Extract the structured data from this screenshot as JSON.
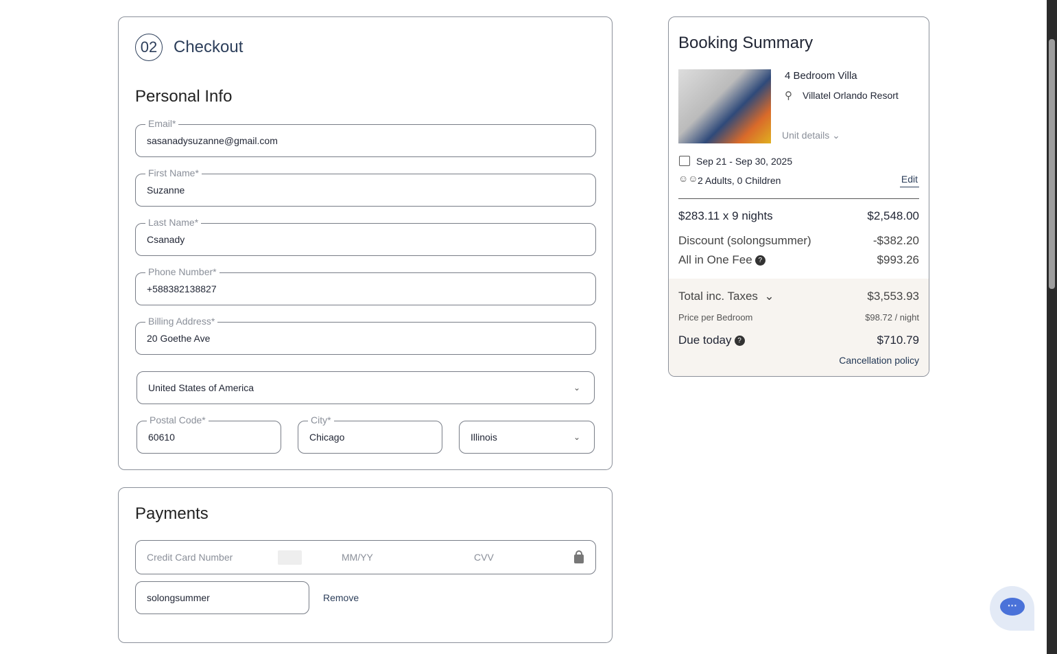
{
  "checkout": {
    "step": "02",
    "title": "Checkout",
    "personal_info": "Personal Info",
    "fields": [
      {
        "label": "Email*",
        "value": "sasanadysuzanne@gmail.com"
      },
      {
        "label": "First Name*",
        "value": "Suzanne"
      },
      {
        "label": "Last Name*",
        "value": "Csanady"
      },
      {
        "label": "Phone Number*",
        "value": "+588382138827"
      },
      {
        "label": "Billing Address*",
        "value": "20 Goethe Ave"
      }
    ],
    "country": "United States of America",
    "postal": {
      "label": "Postal Code*",
      "value": "60610"
    },
    "city": {
      "label": "City*",
      "value": "Chicago"
    },
    "state": "Illinois"
  },
  "payments": {
    "title": "Payments",
    "card_placeholder": "Credit Card Number",
    "expiry_placeholder": "MM/YY",
    "cvv_placeholder": "CVV",
    "promo": "solongsummer",
    "remove": "Remove"
  },
  "summary": {
    "title": "Booking Summary",
    "unit": "4 Bedroom Villa",
    "location": "Villatel Orlando Resort",
    "unit_details": "Unit details",
    "dates": "Sep 21 - Sep 30, 2025",
    "guests": "2 Adults, 0 Children",
    "edit": "Edit",
    "nights_label": "$283.11 x 9 nights",
    "nights_value": "$2,548.00",
    "discount_label": "Discount (solongsummer)",
    "discount_value": "-$382.20",
    "fee_label": "All in One Fee",
    "fee_value": "$993.26",
    "total_label": "Total inc. Taxes",
    "total_value": "$3,553.93",
    "per_bedroom_label": "Price per Bedroom",
    "per_bedroom_value": "$98.72 / night",
    "due_label": "Due today",
    "due_value": "$710.79",
    "cancellation": "Cancellation policy"
  }
}
